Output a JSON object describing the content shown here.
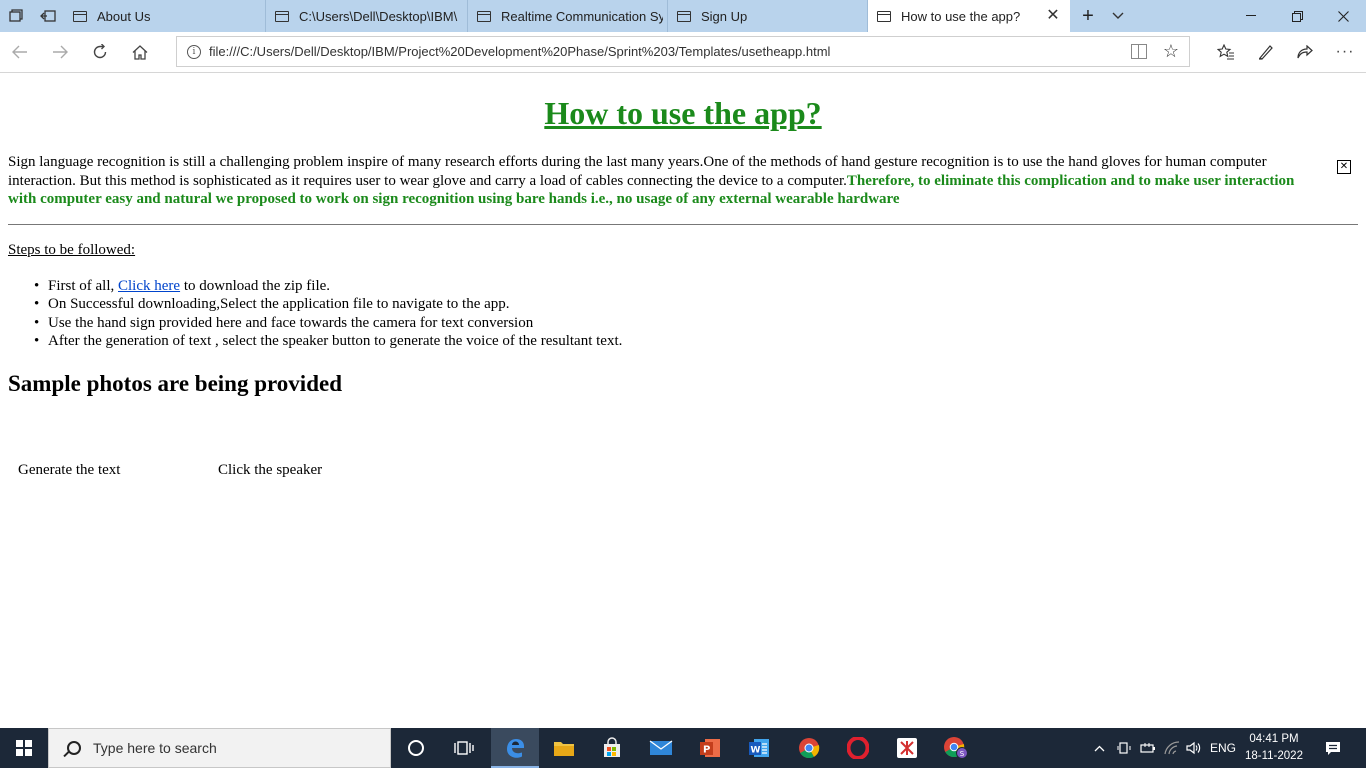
{
  "browser": {
    "tabs": [
      {
        "label": "About Us"
      },
      {
        "label": "C:\\Users\\Dell\\Desktop\\IBM\\"
      },
      {
        "label": "Realtime Communication Sy"
      },
      {
        "label": "Sign Up"
      },
      {
        "label": "How to use the app?"
      }
    ],
    "active_tab": 4,
    "url": "file:///C:/Users/Dell/Desktop/IBM/Project%20Development%20Phase/Sprint%203/Templates/usetheapp.html"
  },
  "page": {
    "title": "How to use the app?",
    "intro_text": "Sign language recognition is still a challenging problem inspire of many research efforts during the last many years.One of the methods of hand gesture recognition is to use the hand gloves for human computer interaction. But this method is sophisticated as it requires user to wear glove and carry a load of cables connecting the device to a computer.",
    "intro_highlight": "Therefore, to eliminate this complication and to make user interaction with computer easy and natural we proposed to work on sign recognition using bare hands i.e., no usage of any external wearable hardware",
    "steps_heading": "Steps to be followed:",
    "steps": {
      "s1_prefix": "First of all, ",
      "s1_link": "Click here",
      "s1_suffix": " to download the zip file.",
      "s2": "On Successful downloading,Select the application file to navigate to the app.",
      "s3": "Use the hand sign provided here and face towards the camera for text conversion",
      "s4": "After the generation of text , select the speaker button to generate the voice of the resultant text."
    },
    "samples_heading": "Sample photos are being provided",
    "captions": [
      "Generate the text",
      "Click the speaker"
    ]
  },
  "taskbar": {
    "search_placeholder": "Type here to search",
    "language": "ENG",
    "time": "04:41 PM",
    "date": "18-11-2022"
  },
  "colors": {
    "accent_green": "#1b8a1b",
    "link_blue": "#0044cc",
    "taskbar_bg": "#1c2838",
    "tabbar_bg": "#b9d3ec"
  }
}
